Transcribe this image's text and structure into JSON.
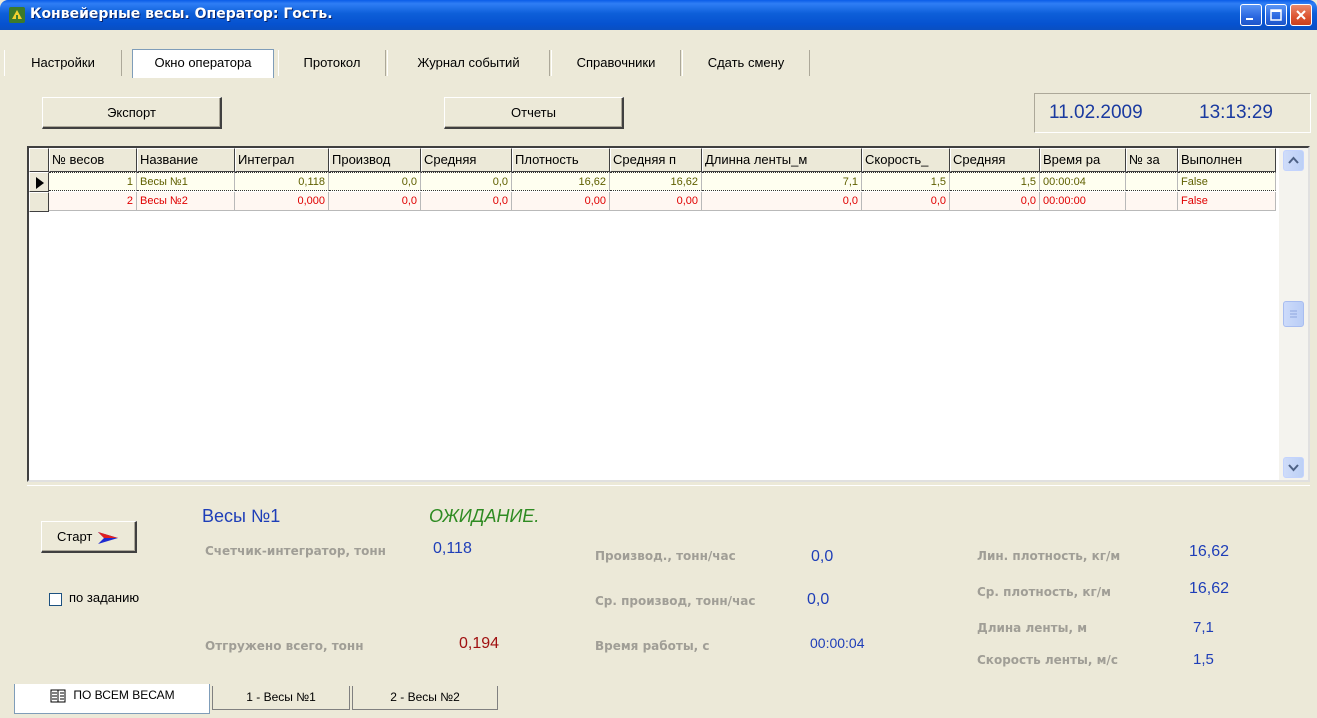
{
  "window": {
    "title": "Конвейерные весы. Оператор: Гость.",
    "controls": [
      "minimize",
      "maximize",
      "close"
    ]
  },
  "menu_tabs": [
    {
      "label": "Настройки",
      "active": false
    },
    {
      "label": "Окно оператора",
      "active": true
    },
    {
      "label": "Протокол",
      "active": false
    },
    {
      "label": "Журнал событий",
      "active": false
    },
    {
      "label": "Справочники",
      "active": false
    },
    {
      "label": "Сдать смену",
      "active": false
    }
  ],
  "toolbar": {
    "export_label": "Экспорт",
    "reports_label": "Отчеты",
    "date": "11.02.2009",
    "time": "13:13:29"
  },
  "grid": {
    "columns": [
      "№ весов",
      "Название",
      "Интеграл",
      "Производ",
      "Средняя",
      "Плотность",
      "Средняя п",
      "Длинна ленты_м",
      "Скорость_",
      "Средняя",
      "Время ра",
      "№ за",
      "Выполнен"
    ],
    "rows": [
      {
        "cells": [
          "1",
          "Весы №1",
          "0,118",
          "0,0",
          "0,0",
          "16,62",
          "16,62",
          "7,1",
          "1,5",
          "1,5",
          "00:00:04",
          "",
          "False"
        ],
        "selected": true
      },
      {
        "cells": [
          "2",
          "Весы №2",
          "0,000",
          "0,0",
          "0,0",
          "0,00",
          "0,00",
          "0,0",
          "0,0",
          "0,0",
          "00:00:00",
          "",
          "False"
        ],
        "selected": false
      }
    ]
  },
  "panel": {
    "start_label": "Старт",
    "by_task_label": "по заданию",
    "by_task_checked": false,
    "scale_name": "Весы №1",
    "status": "ОЖИДАНИЕ.",
    "counter_label": "Счетчик-интегратор, тонн",
    "counter_value": "0,118",
    "shipped_label": "Отгружено всего, тонн",
    "shipped_value": "0,194",
    "prod_label": "Производ., тонн/час",
    "prod_value": "0,0",
    "avg_prod_label": "Ср. производ, тонн/час",
    "avg_prod_value": "0,0",
    "work_time_label": "Время работы, с",
    "work_time_value": "00:00:04",
    "lin_density_label": "Лин. плотность, кг/м",
    "lin_density_value": "16,62",
    "avg_density_label": "Ср. плотность, кг/м",
    "avg_density_value": "16,62",
    "belt_length_label": "Длина ленты, м",
    "belt_length_value": "7,1",
    "belt_speed_label": "Скорость ленты, м/с",
    "belt_speed_value": "1,5"
  },
  "bottom_tabs": [
    {
      "label": "ПО ВСЕМ ВЕСАМ",
      "active": true
    },
    {
      "label": "1 - Весы №1",
      "active": false
    },
    {
      "label": "2 - Весы №2",
      "active": false
    }
  ],
  "colors": {
    "titlebar": "#0a5ce8",
    "value_blue": "#1e3eb8",
    "status_green": "#2e8b22",
    "shipped_red": "#a01010",
    "row2_red": "#e00000"
  }
}
